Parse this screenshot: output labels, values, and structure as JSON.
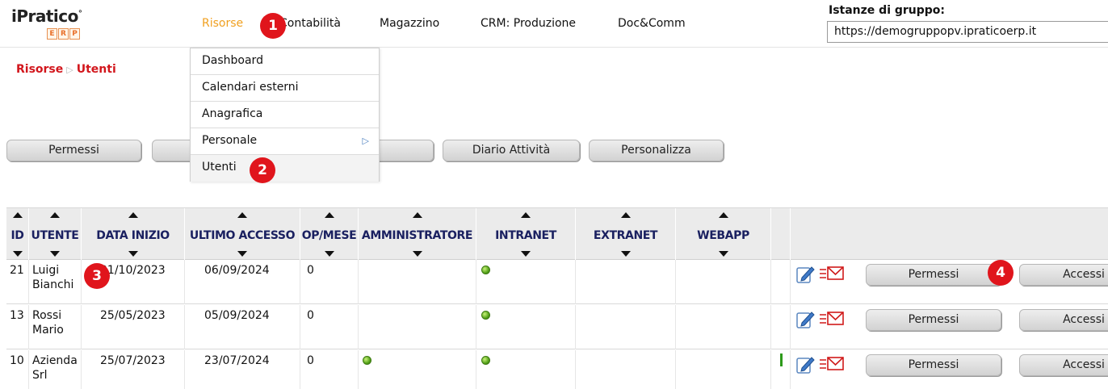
{
  "app": {
    "logo_name": "iPratico",
    "logo_mark": "°",
    "logo_sub": [
      "E",
      "R",
      "P"
    ]
  },
  "nav": {
    "items": [
      "Risorse",
      "Contabilità",
      "Magazzino",
      "CRM: Produzione",
      "Doc&Comm"
    ],
    "active": "Risorse"
  },
  "istanze": {
    "label": "Istanze di gruppo:",
    "value": "https://demogruppopv.ipraticoerp.it"
  },
  "breadcrumb": {
    "root": "Risorse",
    "separator": "▷",
    "current": "Utenti"
  },
  "actions": {
    "permessi": "Permessi",
    "diario": "Diario Attività",
    "personalizza": "Personalizza"
  },
  "dropdown": {
    "items": [
      "Dashboard",
      "Calendari esterni",
      "Anagrafica",
      "Personale",
      "Utenti"
    ],
    "submenu_arrow": "▷"
  },
  "badges": [
    "1",
    "2",
    "3",
    "4"
  ],
  "table": {
    "columns": [
      "ID",
      "UTENTE",
      "DATA INIZIO",
      "ULTIMO ACCESSO",
      "OP/MESE",
      "AMMINISTRATORE",
      "INTRANET",
      "EXTRANET",
      "WEBAPP"
    ],
    "rows": [
      {
        "id": "21",
        "utente": [
          "Luigi",
          "Bianchi"
        ],
        "data_inizio": "01/10/2023",
        "ultimo_accesso": "06/09/2024",
        "op_mese": "0",
        "amministratore": false,
        "intranet": true,
        "extranet": false,
        "webapp": false,
        "marker": false
      },
      {
        "id": "13",
        "utente": [
          "Rossi",
          "Mario"
        ],
        "data_inizio": "25/05/2023",
        "ultimo_accesso": "05/09/2024",
        "op_mese": "0",
        "amministratore": false,
        "intranet": true,
        "extranet": false,
        "webapp": false,
        "marker": false
      },
      {
        "id": "10",
        "utente": [
          "Azienda",
          "Srl"
        ],
        "data_inizio": "25/07/2023",
        "ultimo_accesso": "23/07/2024",
        "op_mese": "0",
        "amministratore": true,
        "intranet": true,
        "extranet": false,
        "webapp": false,
        "marker": true
      }
    ],
    "row_buttons": {
      "permessi": "Permessi",
      "accessi": "Accessi"
    }
  },
  "icons": [
    "edit-icon",
    "email-icon",
    "status-dot-icon",
    "sort-up-icon",
    "sort-down-icon",
    "submenu-arrow-icon"
  ],
  "colors": {
    "accent_red": "#e0151c",
    "active_nav": "#f0a020",
    "breadcrumb": "#d2161c",
    "status_green": "#56a31a",
    "header_text": "#1a2060"
  }
}
